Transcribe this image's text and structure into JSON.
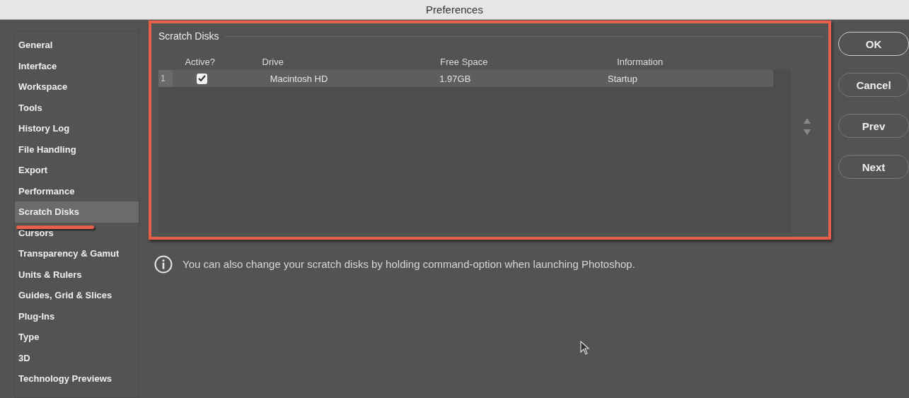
{
  "window": {
    "title": "Preferences"
  },
  "sidebar": {
    "items": [
      {
        "label": "General",
        "selected": false
      },
      {
        "label": "Interface",
        "selected": false
      },
      {
        "label": "Workspace",
        "selected": false
      },
      {
        "label": "Tools",
        "selected": false
      },
      {
        "label": "History Log",
        "selected": false
      },
      {
        "label": "File Handling",
        "selected": false
      },
      {
        "label": "Export",
        "selected": false
      },
      {
        "label": "Performance",
        "selected": false
      },
      {
        "label": "Scratch Disks",
        "selected": true
      },
      {
        "label": "Cursors",
        "selected": false
      },
      {
        "label": "Transparency & Gamut",
        "selected": false
      },
      {
        "label": "Units & Rulers",
        "selected": false
      },
      {
        "label": "Guides, Grid & Slices",
        "selected": false
      },
      {
        "label": "Plug-Ins",
        "selected": false
      },
      {
        "label": "Type",
        "selected": false
      },
      {
        "label": "3D",
        "selected": false
      },
      {
        "label": "Technology Previews",
        "selected": false
      }
    ]
  },
  "group": {
    "title": "Scratch Disks",
    "table": {
      "columns": [
        "Active?",
        "Drive",
        "Free Space",
        "Information"
      ],
      "rows": [
        {
          "index": "1",
          "checked": true,
          "selected": true,
          "drive": "Macintosh HD",
          "free_space": "1.97GB",
          "information": "Startup"
        }
      ]
    }
  },
  "info": {
    "text": "You can also change your scratch disks by holding command-option when launching Photoshop."
  },
  "buttons": [
    {
      "label": "OK",
      "default": true
    },
    {
      "label": "Cancel",
      "default": false
    },
    {
      "label": "Prev",
      "default": false
    },
    {
      "label": "Next",
      "default": false
    }
  ]
}
